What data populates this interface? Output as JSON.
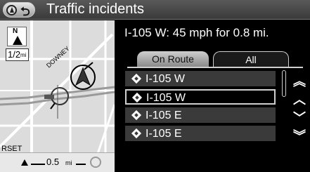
{
  "header": {
    "title": "Traffic incidents",
    "back_icon": "back-arrow-icon",
    "nav_icon": "navigation-icon"
  },
  "map": {
    "scale_value": "1/2",
    "scale_unit": "mi",
    "compass_letter": "N",
    "street_downey": "DOWNEY",
    "street_partial": "RSET",
    "distance_value": "0.5",
    "distance_unit": "mi"
  },
  "detail": {
    "headline": "I-105 W: 45 mph for 0.8 mi."
  },
  "tabs": [
    {
      "label": "On Route"
    },
    {
      "label": "All"
    }
  ],
  "incidents": [
    {
      "label": "I-105 W"
    },
    {
      "label": "I-105 W"
    },
    {
      "label": "I-105 E"
    },
    {
      "label": "I-105 E"
    }
  ],
  "scroll_arrows": [
    "page-up-icon",
    "up-icon",
    "down-icon",
    "page-down-icon"
  ]
}
